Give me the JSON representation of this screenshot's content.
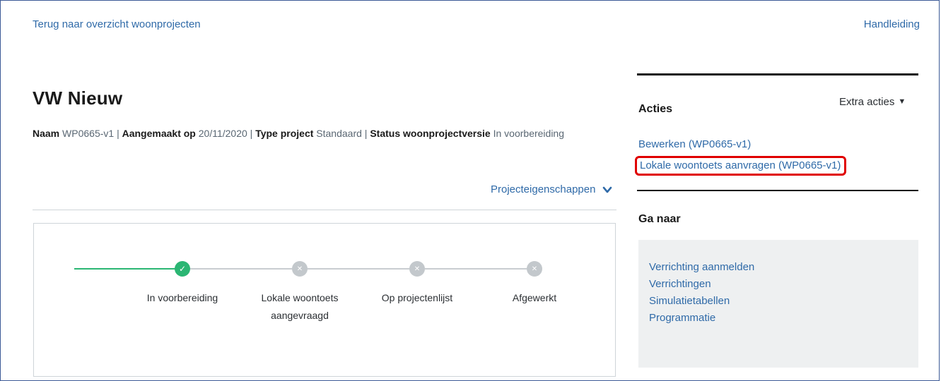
{
  "header": {
    "back_link": "Terug naar overzicht woonprojecten",
    "manual_link": "Handleiding"
  },
  "project": {
    "title": "VW Nieuw",
    "meta": {
      "name_label": "Naam",
      "name_value": "WP0665-v1",
      "created_label": "Aangemaakt op",
      "created_value": "20/11/2020",
      "type_label": "Type project",
      "type_value": "Standaard",
      "status_label": "Status woonprojectversie",
      "status_value": "In voorbereiding",
      "separator": "|"
    },
    "properties_toggle": "Projecteigenschappen"
  },
  "timeline": {
    "steps": [
      {
        "label_line1": "In voorbereiding",
        "label_line2": "",
        "state": "done"
      },
      {
        "label_line1": "Lokale woontoets",
        "label_line2": "aangevraagd",
        "state": "todo"
      },
      {
        "label_line1": "Op projectenlijst",
        "label_line2": "",
        "state": "todo"
      },
      {
        "label_line1": "Afgewerkt",
        "label_line2": "",
        "state": "todo"
      }
    ]
  },
  "actions": {
    "title": "Acties",
    "extra_actions": "Extra acties",
    "items": [
      {
        "label": "Bewerken (WP0665-v1)"
      },
      {
        "label": "Lokale woontoets aanvragen (WP0665-v1)",
        "highlighted": true
      }
    ]
  },
  "goto": {
    "title": "Ga naar",
    "items": [
      {
        "label": "Verrichting aanmelden"
      },
      {
        "label": "Verrichtingen"
      },
      {
        "label": "Simulatietabellen"
      },
      {
        "label": "Programmatie"
      }
    ]
  },
  "colors": {
    "link": "#2f6aa8",
    "done": "#2bb673",
    "todo": "#c3c8cc",
    "highlight": "#e00000"
  }
}
